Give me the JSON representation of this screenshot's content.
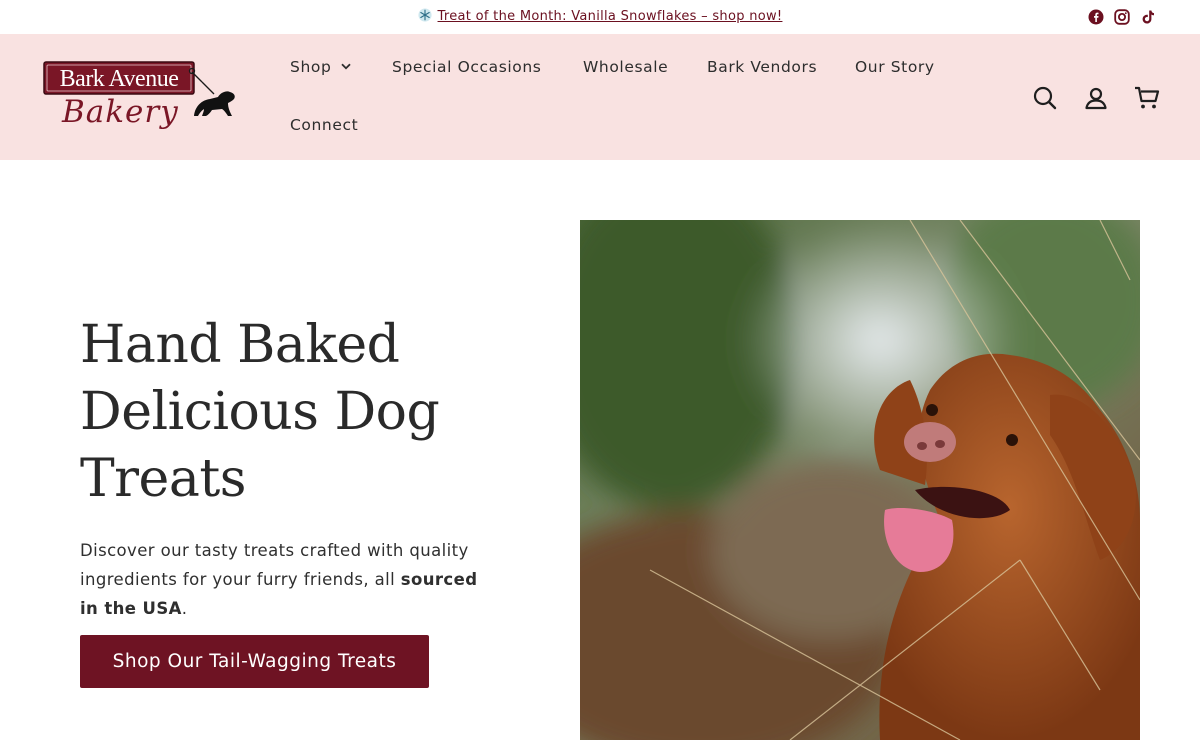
{
  "announcement": {
    "text": "Treat of the Month: Vanilla Snowflakes – shop now!",
    "icon": "snowflake-icon"
  },
  "social": [
    "facebook-icon",
    "instagram-icon",
    "tiktok-icon"
  ],
  "header": {
    "logo": {
      "line1": "Bark Avenue",
      "line2": "Bakery"
    },
    "nav": [
      {
        "label": "Shop",
        "has_dropdown": true
      },
      {
        "label": "Special Occasions"
      },
      {
        "label": "Wholesale"
      },
      {
        "label": "Bark Vendors"
      },
      {
        "label": "Our Story"
      },
      {
        "label": "Connect"
      }
    ],
    "icons": [
      "search-icon",
      "account-icon",
      "cart-icon"
    ]
  },
  "hero": {
    "title": "Hand Baked Delicious Dog Treats",
    "description_plain": "Discover our tasty treats crafted with quality ingredients for your furry friends, all ",
    "description_bold": "sourced in the USA",
    "description_end": ".",
    "cta_label": "Shop Our Tail-Wagging Treats"
  },
  "colors": {
    "header_bg": "#f9e2e1",
    "brand_maroon": "#6e1323",
    "text_dark": "#2b2b2b"
  }
}
